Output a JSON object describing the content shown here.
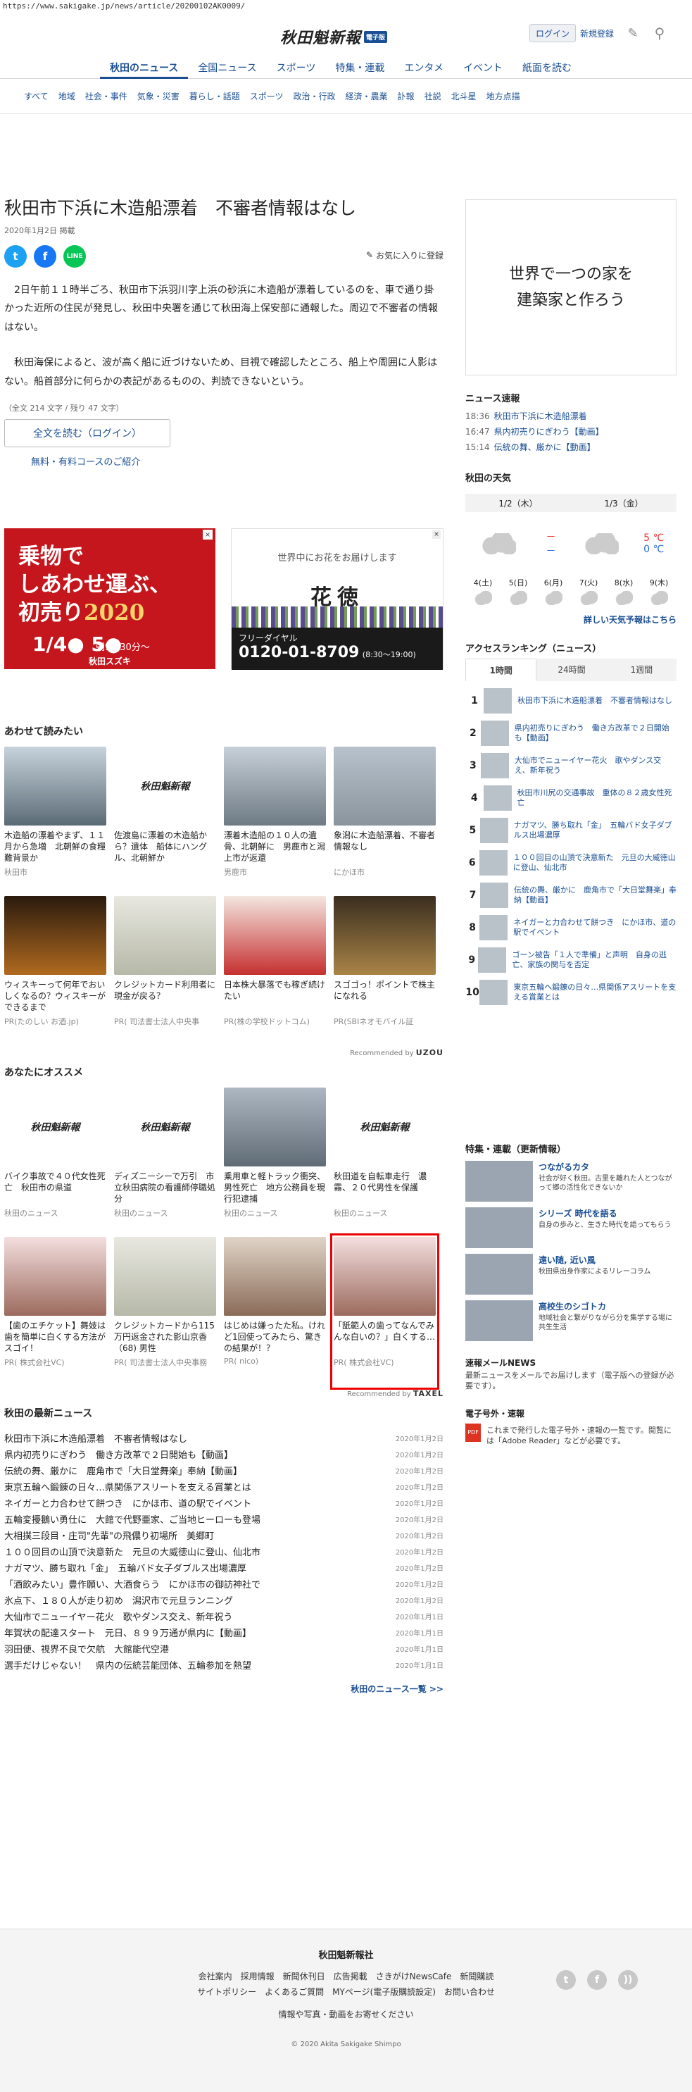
{
  "url": "https://www.sakigake.jp/news/article/20200102AK0009/",
  "header": {
    "logo_text": "秋田魁新報",
    "logo_badge": "電子版",
    "login": "ログイン",
    "register": "新規登録"
  },
  "nav": [
    "秋田のニュース",
    "全国ニュース",
    "スポーツ",
    "特集・連載",
    "エンタメ",
    "イベント",
    "紙面を読む"
  ],
  "subnav": [
    "すべて",
    "地域",
    "社会・事件",
    "気象・災害",
    "暮らし・話題",
    "スポーツ",
    "政治・行政",
    "経済・農業",
    "訃報",
    "社説",
    "北斗星",
    "地方点描"
  ],
  "article": {
    "title": "秋田市下浜に木造船漂着　不審者情報はなし",
    "date": "2020年1月2日 掲載",
    "favorite": "お気に入りに登録",
    "p1": "2日午前１１時半ごろ、秋田市下浜羽川字上浜の砂浜に木造船が漂着しているのを、車で通り掛かった近所の住民が発見し、秋田中央署を通じて秋田海上保安部に通報した。周辺で不審者の情報はない。",
    "p2": "秋田海保によると、波が高く船に近づけないため、目視で確認したところ、船上や周囲に人影はない。船首部分に何らかの表記があるものの、判読できないという。",
    "wordcount": "（全文 214 文字 / 残り 47 文字）",
    "read_full": "全文を読む（ログイン）",
    "course": "無料・有料コースのご紹介"
  },
  "ad_left": {
    "line1": "乗物で",
    "line2": "しあわせ運ぶ、",
    "line3": "初売り",
    "year": "2020",
    "date": "1/4● 5●",
    "time": "朝9時30分～",
    "sponsor": "秋田スズキ"
  },
  "ad_right": {
    "tag": "世界中にお花をお届けします",
    "name": "花徳",
    "freedial": "フリーダイヤル",
    "phone": "0120-01-8709",
    "hours": "(8:30～19:00)"
  },
  "related": {
    "heading": "あわせて読みたい",
    "items": [
      {
        "title": "木造船の漂着やまず、１１月から急増　北朝鮮の食糧難背景か",
        "src": "秋田市"
      },
      {
        "title": "佐渡島に漂着の木造船から？遺体　船体にハングル、北朝鮮か",
        "src": ""
      },
      {
        "title": "漂着木造船の１０人の遺骨、北朝鮮に　男鹿市と潟上市が返還",
        "src": "男鹿市"
      },
      {
        "title": "象潟に木造船漂着、不審者情報なし",
        "src": "にかほ市"
      },
      {
        "title": "ウィスキーって何年でおいしくなるの？ウィスキーができるまで",
        "src": "PR(たのしい お酒.jp)"
      },
      {
        "title": "クレジットカード利用者に現金が戻る？",
        "src": "PR( 司法書士法人中央事"
      },
      {
        "title": "日本株大暴落でも稼ぎ続けたい",
        "src": "PR(株の学校ドットコム)"
      },
      {
        "title": "スゴゴっ！ポイントで株主になれる",
        "src": "PR(SBIネオモバイル証"
      }
    ],
    "attribution": "Recommended by",
    "attribution_brand": "UZOU"
  },
  "recommend": {
    "heading": "あなたにオススメ",
    "items": [
      {
        "title": "バイク事故で４０代女性死亡　秋田市の県道",
        "src": "秋田のニュース"
      },
      {
        "title": "ディズニーシーで万引　市立秋田病院の看護師停職処分",
        "src": "秋田のニュース"
      },
      {
        "title": "乗用車と軽トラック衝突、男性死亡　地方公務員を現行犯逮捕",
        "src": "秋田のニュース"
      },
      {
        "title": "秋田道を自転車走行　濃霧、２０代男性を保護",
        "src": "秋田のニュース"
      },
      {
        "title": "【歯のエチケット】舞妓は歯を簡単に白くする方法がスゴイ！",
        "src": "PR( 株式会社VC)"
      },
      {
        "title": "クレジットカードから115万円返金された影山京香（68) 男性",
        "src": "PR( 司法書士法人中央事務"
      },
      {
        "title": "はじめは嫌ったた私。けれど1回使ってみたら、驚きの結果が！？",
        "src": "PR( nico)"
      },
      {
        "title": "「舐範人の歯ってなんでみんな白いの？」白くする…",
        "src": "PR( 株式会社VC)"
      }
    ],
    "attribution": "Recommended by",
    "attribution_brand": "TAXEL"
  },
  "latest": {
    "heading": "秋田の最新ニュース",
    "items": [
      {
        "title": "秋田市下浜に木造船漂着　不審者情報はなし",
        "date": "2020年1月2日"
      },
      {
        "title": "県内初売りにぎわう　働き方改革で２日開始も【動画】",
        "date": "2020年1月2日"
      },
      {
        "title": "伝統の舞、厳かに　鹿角市で「大日堂舞楽」奉納【動画】",
        "date": "2020年1月2日"
      },
      {
        "title": "東京五輪へ鍛錬の日々…県関係アスリートを支える賞業とは",
        "date": "2020年1月2日"
      },
      {
        "title": "ネイガーと力合わせて餅つき　にかほ市、道の駅でイベント",
        "date": "2020年1月2日"
      },
      {
        "title": "五輪変擾鵝い勇仕に　大館で代野亜家、ご当地ヒーローも登場",
        "date": "2020年1月2日"
      },
      {
        "title": "大相撲三段目・庄司\"先輩\"の飛儂り初場所　美郷町",
        "date": "2020年1月2日"
      },
      {
        "title": "１００回目の山頂で決意新た　元旦の大威徳山に登山、仙北市",
        "date": "2020年1月2日"
      },
      {
        "title": "ナガマツ、勝ち取れ「金」　五輪バド女子ダブルス出場濃厚",
        "date": "2020年1月2日"
      },
      {
        "title": "「酒飲みたい」豊作願い、大酒食らう　にかほ市の御訪神社で",
        "date": "2020年1月2日"
      },
      {
        "title": "氷点下、１８０人が走り初め　潟沢市で元旦ランニング",
        "date": "2020年1月2日"
      },
      {
        "title": "大仙市でニューイヤー花火　歌やダンス交え、新年祝う",
        "date": "2020年1月1日"
      },
      {
        "title": "年賀状の配達スタート　元日、８９９万通が県内に【動画】",
        "date": "2020年1月1日"
      },
      {
        "title": "羽田便、視界不良で欠航　大館能代空港",
        "date": "2020年1月1日"
      },
      {
        "title": "選手だけじゃない！　県内の伝統芸能団体、五輪参加を熱望",
        "date": "2020年1月1日"
      }
    ],
    "more": "秋田のニュース一覧 >>"
  },
  "sidebar": {
    "ad_line1": "世界で一つの家を",
    "ad_line2": "建築家と作ろう",
    "flash_heading": "ニュース速報",
    "flash": [
      {
        "time": "18:36",
        "title": "秋田市下浜に木造船漂着"
      },
      {
        "time": "16:47",
        "title": "県内初売りにぎわう【動画】"
      },
      {
        "time": "15:14",
        "title": "伝統の舞、厳かに【動画】"
      }
    ],
    "weather_heading": "秋田の天気",
    "weather_day1": "1/2（木）",
    "weather_day2": "1/3（金）",
    "weather_day1_hi": "－",
    "weather_day1_lo": "－",
    "weather_day2_hi": "5 ℃",
    "weather_day2_lo": "0 ℃",
    "weather_week": [
      "4(土)",
      "5(日)",
      "6(月)",
      "7(火)",
      "8(水)",
      "9(木)"
    ],
    "weather_link": "詳しい天気予報はこちら",
    "ranking_heading": "アクセスランキング（ニュース）",
    "ranking_tabs": [
      "1時間",
      "24時間",
      "1週間"
    ],
    "ranking": [
      "秋田市下浜に木造船漂着　不審者情報はなし",
      "県内初売りにぎわう　働き方改革で２日開始も【動画】",
      "大仙市でニューイヤー花火　歌やダンス交え、新年祝う",
      "秋田市川尻の交通事故　重体の８２歳女性死亡",
      "ナガマツ、勝ち取れ「金」　五輪バド女子ダブルス出場濃厚",
      "１００回目の山頂で決意新た　元旦の大威徳山に登山、仙北市",
      "伝統の舞、厳かに　鹿角市で「大日堂舞楽」奉納【動画】",
      "ネイガーと力合わせて餅つき　にかほ市、道の駅でイベント",
      "ゴーン被告「１人で準備」と声明　自身の逃亡、家族の関与を否定",
      "東京五輪へ鍛錬の日々…県関係アスリートを支える賞業とは"
    ],
    "features_heading": "特集・連載（更新情報）",
    "features": [
      {
        "title": "つながるカタ",
        "desc": "社会が好く秋田。古里を離れた人とつながって郷の活性化できないか"
      },
      {
        "title": "シリーズ 時代を語る",
        "desc": "自身の歩みと、生きた時代を語ってもらう"
      },
      {
        "title": "遠い随, 近い風",
        "desc": "秋田県出身作家によるリレーコラム"
      },
      {
        "title": "高校生のシゴトカ",
        "desc": "地域社会と繋がりながら分を集学する場に共生生活"
      }
    ],
    "mail_title": "速報メールNEWS",
    "mail_desc": "最新ニュースをメールでお届けします（電子版への登録が必要です）。",
    "extra_title": "電子号外・速報",
    "extra_desc": "これまで発行した電子号外・速報の一覧です。閲覧には「Adobe Reader」などが必要です。"
  },
  "footer": {
    "title": "秋田魁新報社",
    "links1": [
      "会社案内",
      "採用情報",
      "新聞休刊日",
      "広告掲載",
      "さきがけNewsCafe",
      "新聞購読"
    ],
    "links2": [
      "サイトポリシー",
      "よくあるご質問",
      "MYページ(電子版購読設定)",
      "お問い合わせ"
    ],
    "links3": "情報や写真・動画をお寄せください",
    "copyright": "© 2020 Akita Sakigake Shimpo"
  }
}
